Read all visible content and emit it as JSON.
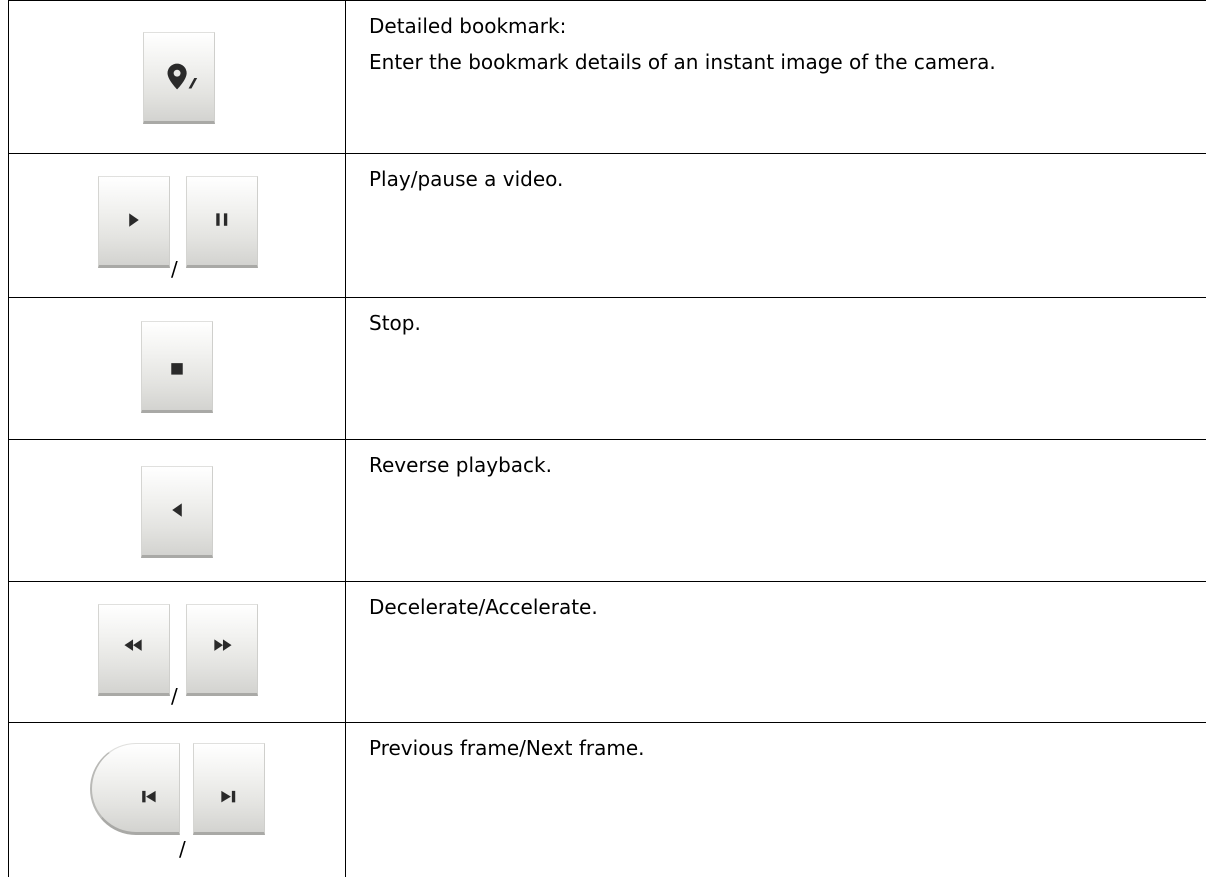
{
  "rows": [
    {
      "icons": [
        "bookmark-edit-icon"
      ],
      "lines": [
        "Detailed bookmark:",
        "Enter the bookmark details of an instant image of the camera."
      ]
    },
    {
      "icons": [
        "play-icon",
        "pause-icon"
      ],
      "separator": "/",
      "lines": [
        "Play/pause a video."
      ]
    },
    {
      "icons": [
        "stop-icon"
      ],
      "lines": [
        "Stop."
      ]
    },
    {
      "icons": [
        "reverse-play-icon"
      ],
      "lines": [
        "Reverse playback."
      ]
    },
    {
      "icons": [
        "rewind-icon",
        "fast-forward-icon"
      ],
      "separator": "/",
      "lines": [
        "Decelerate/Accelerate."
      ]
    },
    {
      "icons": [
        "previous-frame-icon",
        "next-frame-icon"
      ],
      "separator": "/",
      "lines": [
        "Previous frame/Next frame."
      ]
    }
  ],
  "colors": {
    "border": "#000000",
    "icon": "#2a2a2a",
    "button_bottom": "#a9a9a6"
  }
}
